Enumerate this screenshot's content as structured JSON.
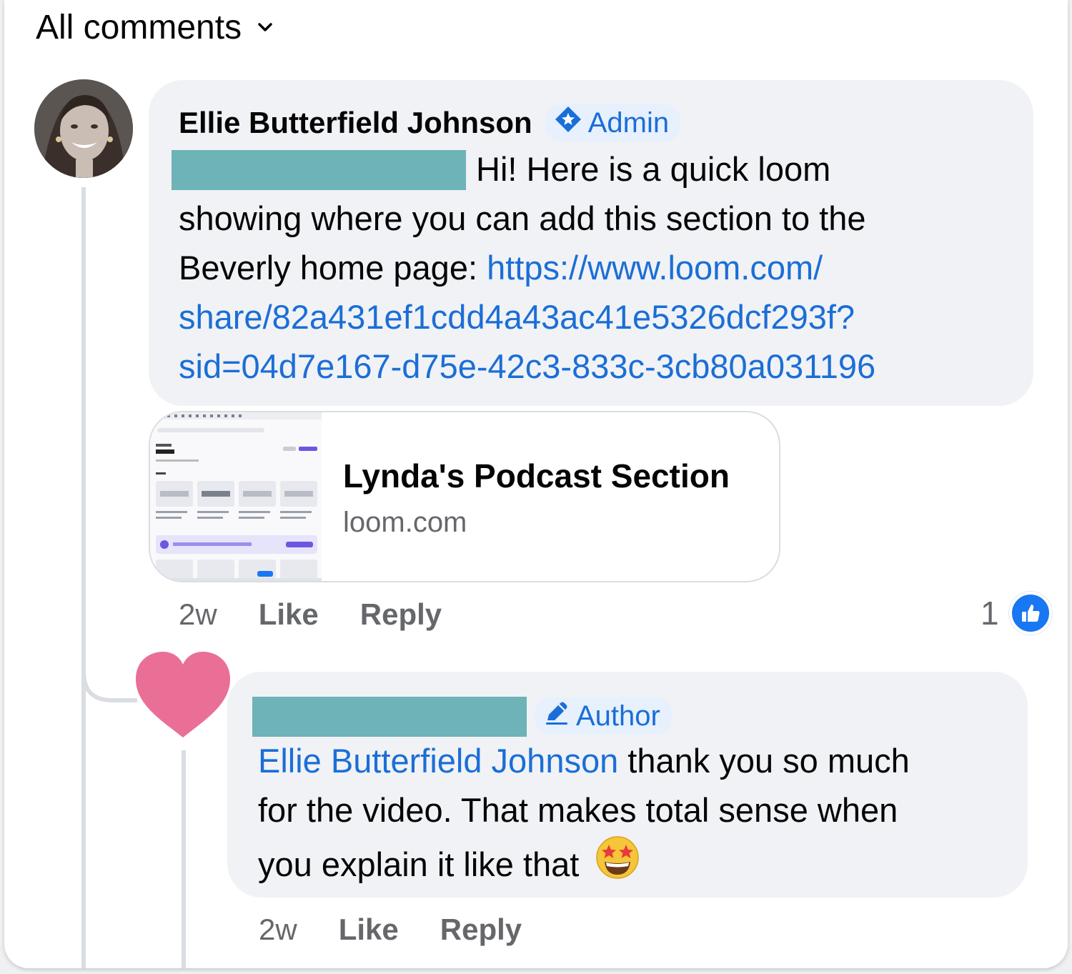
{
  "header": {
    "sort_label": "All comments"
  },
  "comment": {
    "author": "Ellie Butterfield Johnson",
    "badge": "Admin",
    "text_line1": "Hi! Here is a quick loom",
    "text_line2": "showing where you can add this section to the",
    "text_line3_prefix": "Beverly home page: ",
    "link_line1": "https://www.loom.com/",
    "link_line2": "share/82a431ef1cdd4a43ac41e5326dcf293f?",
    "link_line3": "sid=04d7e167-d75e-42c3-833c-3cb80a031196",
    "preview": {
      "title": "Lynda's Podcast Section",
      "domain": "loom.com"
    },
    "time": "2w",
    "like_label": "Like",
    "reply_label": "Reply",
    "reaction_count": "1"
  },
  "reply": {
    "badge": "Author",
    "mention": "Ellie Butterfield Johnson",
    "text_line1_suffix": " thank you so much",
    "text_line2": "for the video. That makes total sense when",
    "text_line3": "you explain it like that",
    "time": "2w",
    "like_label": "Like",
    "reply_label": "Reply"
  },
  "colors": {
    "link": "#1b6ed6",
    "bubble": "#f0f2f5",
    "redaction": "#6db3b8",
    "heart": "#e96f96",
    "like_blue": "#1877f2"
  },
  "icons": {
    "sort": "chevron-down-icon",
    "admin": "admin-badge-icon",
    "author": "pencil-icon",
    "reaction": "thumbs-up-icon",
    "heart": "heart-icon",
    "emoji": "star-struck-emoji"
  }
}
